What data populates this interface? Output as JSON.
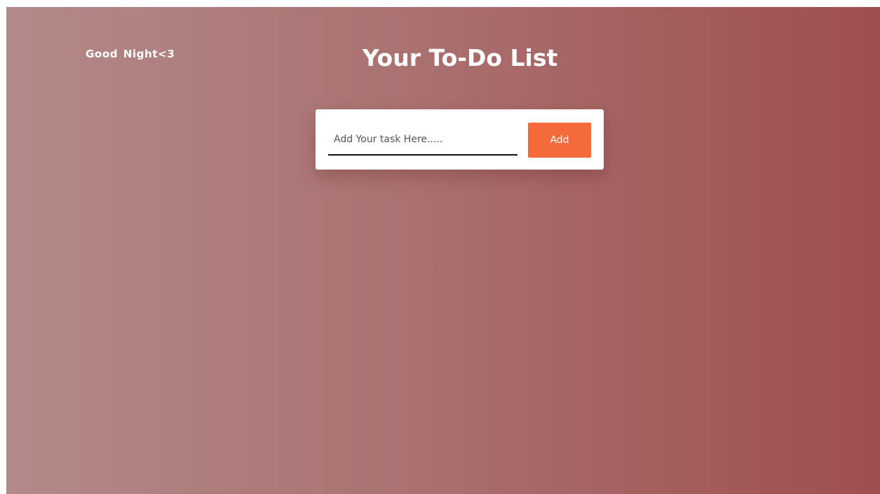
{
  "header": {
    "greeting": "Good Night<3",
    "title": "Your To-Do List"
  },
  "task_form": {
    "input_value": "",
    "input_placeholder": "Add Your task Here.....",
    "add_label": "Add"
  },
  "colors": {
    "background_start": "#b38a89",
    "background_end": "#a04e4f",
    "accent_button": "#f46a3a",
    "card": "#ffffff",
    "text_light": "#ffffff"
  }
}
